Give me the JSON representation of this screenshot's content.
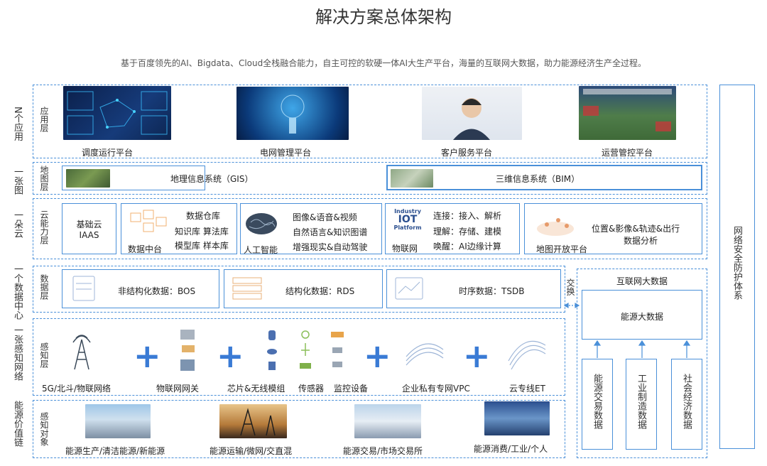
{
  "title": "解决方案总体架构",
  "subtitle": "基于百度领先的AI、Bigdata、Cloud全栈融合能力，自主可控的软硬一体AI大生产平台，海量的互联网大数据，助力能源经济生产全过程。",
  "left_labels": [
    "N个应用",
    "一张图",
    "一朵云",
    "一个数据中心",
    "一张感知网络",
    "能源价值链"
  ],
  "layers": {
    "app": {
      "name": "应用层",
      "items": [
        "调度运行平台",
        "电网管理平台",
        "客户服务平台",
        "运营管控平台"
      ]
    },
    "map": {
      "name": "地图层",
      "items": [
        "地理信息系统（GIS）",
        "三维信息系统（BIM）"
      ]
    },
    "cloud": {
      "name": "云能力层",
      "iaas": [
        "基础云",
        "IAAS"
      ],
      "data_center": {
        "label": "数据中台",
        "lines": [
          "数据仓库",
          "知识库 算法库",
          "模型库 样本库"
        ]
      },
      "ai": {
        "label": "人工智能",
        "lines": [
          "图像&语音&视频",
          "自然语言&知识图谱",
          "增强现实&自动驾驶"
        ]
      },
      "iot": {
        "label": "物联网",
        "logo_top": "Industry",
        "logo_mid": "IOT",
        "logo_bot": "Platform",
        "lines": [
          "连接：接入、解析",
          "理解：存储、建模",
          "唤醒：AI边缘计算"
        ]
      },
      "map_platform": {
        "label": "地图开放平台",
        "lines": [
          "位置&影像&轨迹&出行",
          "数据分析"
        ]
      }
    },
    "data": {
      "name": "数据层",
      "items": [
        "非结构化数据：BOS",
        "结构化数据：RDS",
        "时序数据：TSDB"
      ],
      "exchange": "交换"
    },
    "sense": {
      "name": "感知层",
      "items": [
        "5G/北斗/物联网络",
        "物联网网关",
        "芯片&无线模组",
        "传感器",
        "监控设备",
        "企业私有专网VPC",
        "云专线ET"
      ]
    },
    "objects": {
      "name": "感知对象",
      "items": [
        "能源生产/清洁能源/新能源",
        "能源运输/微网/交直混",
        "能源交易/市场交易所",
        "能源消费/工业/个人"
      ]
    }
  },
  "internet_big_data": {
    "title": "互联网大数据",
    "energy": "能源大数据",
    "columns": [
      "能源交易数据",
      "工业制造数据",
      "社会经济数据"
    ]
  },
  "security": "网络安全防护体系",
  "colors": {
    "accent": "#4a90d9",
    "plus": "#3a7bd5"
  }
}
